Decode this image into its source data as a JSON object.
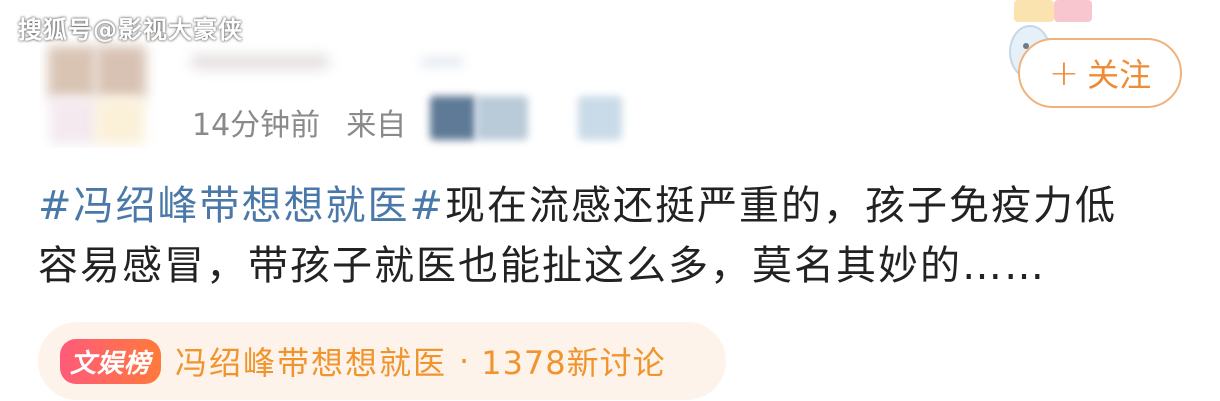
{
  "watermark": "搜狐号@影视大豪侠",
  "post": {
    "time": "14分钟前",
    "source_prefix": "来自",
    "hashtag": "#冯绍峰带想想就医#",
    "body_line1": "现在流感还挺严重的，孩子免疫力低",
    "body_line2": "容易感冒，带孩子就医也能扯这么多，莫名其妙的……"
  },
  "follow_button": {
    "icon": "plus-icon",
    "label": "关注"
  },
  "topic": {
    "badge": "文娱榜",
    "name": "冯绍峰带想想就医",
    "separator": "·",
    "count": "1378新讨论"
  },
  "colors": {
    "hashtag": "#4a78a8",
    "accent_orange": "#f08a33",
    "topic_bg": "#fdf3ea",
    "meta_gray": "#8a8a8a"
  }
}
